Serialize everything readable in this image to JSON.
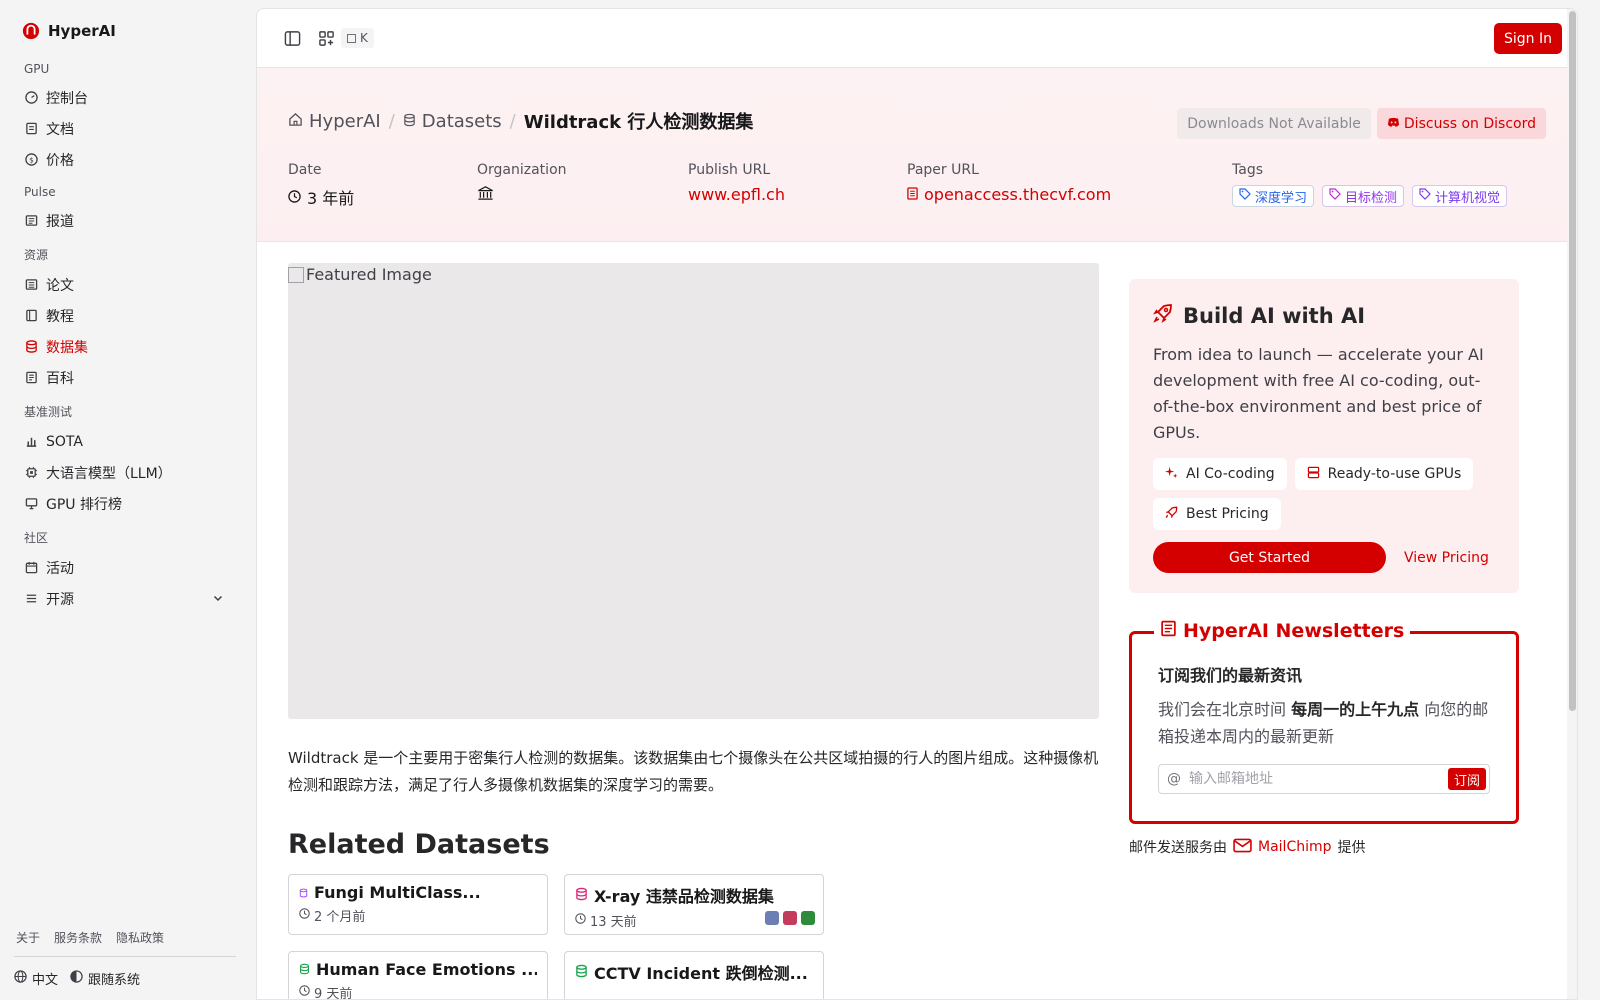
{
  "brand": {
    "name": "HyperAI"
  },
  "sidebar": {
    "sections": [
      {
        "title": "GPU",
        "items": [
          {
            "label": "控制台",
            "icon": "gauge-icon"
          },
          {
            "label": "文档",
            "icon": "book-icon"
          },
          {
            "label": "价格",
            "icon": "dollar-icon"
          }
        ]
      },
      {
        "title": "Pulse",
        "items": [
          {
            "label": "报道",
            "icon": "newspaper-icon"
          }
        ]
      },
      {
        "title": "资源",
        "items": [
          {
            "label": "论文",
            "icon": "paper-icon"
          },
          {
            "label": "教程",
            "icon": "notebook-icon"
          },
          {
            "label": "数据集",
            "icon": "database-icon",
            "active": true
          },
          {
            "label": "百科",
            "icon": "wiki-icon"
          }
        ]
      },
      {
        "title": "基准测试",
        "items": [
          {
            "label": "SOTA",
            "icon": "bar-chart-icon"
          },
          {
            "label": "大语言模型（LLM）",
            "icon": "chip-icon"
          },
          {
            "label": "GPU 排行榜",
            "icon": "monitor-icon"
          }
        ]
      },
      {
        "title": "社区",
        "items": [
          {
            "label": "活动",
            "icon": "calendar-icon"
          },
          {
            "label": "开源",
            "icon": "list-icon"
          }
        ]
      }
    ],
    "footer_links": [
      "关于",
      "服务条款",
      "隐私政策"
    ],
    "language": "中文",
    "theme": "跟随系统"
  },
  "topbar": {
    "shortcut": "K",
    "sign_in": "Sign In"
  },
  "breadcrumb": {
    "home": "HyperAI",
    "section": "Datasets",
    "current": "Wildtrack 行人检测数据集"
  },
  "header_buttons": {
    "downloads": "Downloads Not Available",
    "discord": "Discuss on Discord"
  },
  "meta": {
    "date_label": "Date",
    "date_value": "3 年前",
    "org_label": "Organization",
    "publish_label": "Publish URL",
    "publish_value": "www.epfl.ch",
    "paper_label": "Paper URL",
    "paper_value": "openaccess.thecvf.com",
    "tags_label": "Tags",
    "tags": [
      "深度学习",
      "目标检测",
      "计算机视觉"
    ]
  },
  "featured": {
    "alt": "Featured Image"
  },
  "description": "Wildtrack 是一个主要用于密集行人检测的数据集。该数据集由七个摄像头在公共区域拍摄的行人的图片组成。这种摄像机检测和跟踪方法，满足了行人多摄像机数据集的深度学习的需要。",
  "related": {
    "title": "Related Datasets",
    "items": [
      {
        "title": "Fungi MultiClass...",
        "date": "2 个月前"
      },
      {
        "title": "X-ray 违禁品检测数据集",
        "date": "13 天前"
      },
      {
        "title": "Human Face Emotions ...",
        "date": "9 天前"
      },
      {
        "title": "CCTV Incident 跌倒检测...",
        "date": ""
      }
    ]
  },
  "promo": {
    "title": "Build AI with AI",
    "text": "From idea to launch — accelerate your AI development with free AI co-coding, out-of-the-box environment and best price of GPUs.",
    "chips": [
      "AI Co-coding",
      "Ready-to-use GPUs",
      "Best Pricing"
    ],
    "start": "Get Started",
    "pricing": "View Pricing"
  },
  "newsletter": {
    "title": "HyperAI Newsletters",
    "heading": "订阅我们的最新资讯",
    "text_before": "我们会在北京时间 ",
    "text_bold": "每周一的上午九点",
    "text_after": " 向您的邮箱投递本周内的最新更新",
    "placeholder": "输入邮箱地址",
    "subscribe": "订阅"
  },
  "mailchimp": {
    "before": "邮件发送服务由",
    "name": "MailChimp",
    "after": "提供"
  },
  "colors": {
    "accent": "#d40000"
  }
}
